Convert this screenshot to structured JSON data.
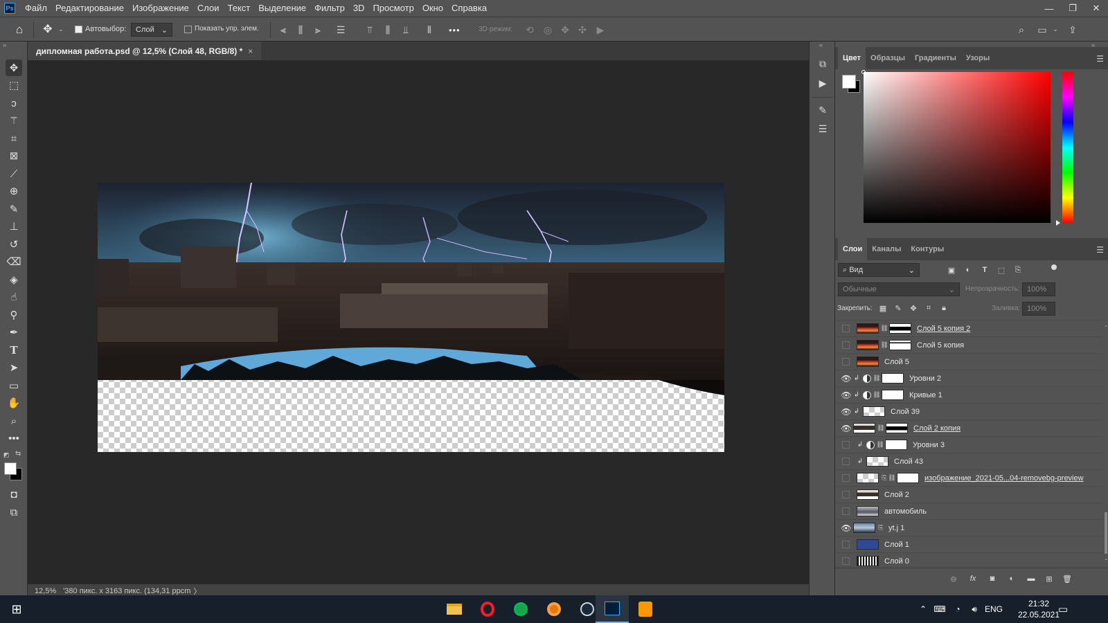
{
  "app": {
    "logo": "Ps"
  },
  "menu": [
    "Файл",
    "Редактирование",
    "Изображение",
    "Слои",
    "Текст",
    "Выделение",
    "Фильтр",
    "3D",
    "Просмотр",
    "Окно",
    "Справка"
  ],
  "options": {
    "autoselect_label": "Автовыбор:",
    "autoselect_checked": true,
    "layer_select": "Слой",
    "show_controls_label": "Показать упр. элем.",
    "show_controls_checked": false,
    "mode_3d_label": "3D-режим:",
    "more": "•••"
  },
  "document": {
    "tab_title": "дипломная работа.psd @ 12,5% (Слой 48, RGB/8) *",
    "close": "×"
  },
  "status": {
    "zoom": "12,5%",
    "info": "'380 пикс. x 3163 пикс. (134,31 ppcm",
    "arrow": "〉"
  },
  "color_panel": {
    "tabs": [
      "Цвет",
      "Образцы",
      "Градиенты",
      "Узоры"
    ],
    "active_tab": "Цвет",
    "foreground": "#ffffff",
    "background": "#000000",
    "hue_color": "#ff0000"
  },
  "layers_panel": {
    "tabs": [
      "Слои",
      "Каналы",
      "Контуры"
    ],
    "active_tab": "Слои",
    "filter_label": "Вид",
    "blend_mode": "Обычные",
    "opacity_label": "Непрозрачность:",
    "opacity_value": "100%",
    "lock_label": "Закрепить:",
    "fill_label": "Заливка:",
    "fill_value": "100%",
    "layers": [
      {
        "name": "Слой 5 копия 2",
        "visible": false,
        "thumb": "fire",
        "mask": "black-shape",
        "underline": true,
        "clip": false,
        "adj": false,
        "link": true
      },
      {
        "name": "Слой 5 копия",
        "visible": false,
        "thumb": "fire",
        "mask": "white-small",
        "underline": false,
        "clip": false,
        "adj": false,
        "link": true
      },
      {
        "name": "Слой 5",
        "visible": false,
        "thumb": "fire",
        "mask": "",
        "underline": false,
        "clip": false,
        "adj": false,
        "link": false
      },
      {
        "name": "Уровни 2",
        "visible": true,
        "thumb": "adj",
        "mask": "white",
        "underline": false,
        "clip": true,
        "adj": true,
        "link": true
      },
      {
        "name": "Кривые 1",
        "visible": true,
        "thumb": "adj",
        "mask": "white",
        "underline": false,
        "clip": true,
        "adj": true,
        "link": true
      },
      {
        "name": "Слой 39",
        "visible": true,
        "thumb": "checker",
        "mask": "",
        "underline": false,
        "clip": true,
        "adj": false,
        "link": false
      },
      {
        "name": "Слой 2 копия",
        "visible": true,
        "thumb": "city",
        "mask": "black-shape",
        "underline": true,
        "clip": false,
        "adj": false,
        "link": true
      },
      {
        "name": "Уровни 3",
        "visible": false,
        "thumb": "adj",
        "mask": "white",
        "underline": false,
        "clip": true,
        "adj": true,
        "link": true
      },
      {
        "name": "Слой 43",
        "visible": false,
        "thumb": "checker",
        "mask": "",
        "underline": false,
        "clip": true,
        "adj": false,
        "link": false
      },
      {
        "name": "изображение_2021-05...04-removebg-preview",
        "visible": false,
        "thumb": "checker",
        "mask": "white",
        "underline": true,
        "clip": false,
        "adj": false,
        "link": true,
        "smart": true
      },
      {
        "name": "Слой 2",
        "visible": false,
        "thumb": "city",
        "mask": "",
        "underline": false,
        "clip": false,
        "adj": false,
        "link": false
      },
      {
        "name": "автомобиль",
        "visible": false,
        "thumb": "car",
        "mask": "",
        "underline": false,
        "clip": false,
        "adj": false,
        "link": false
      },
      {
        "name": "yt.j 1",
        "visible": true,
        "thumb": "sky",
        "mask": "",
        "underline": false,
        "clip": false,
        "adj": false,
        "link": false,
        "smart": true
      },
      {
        "name": "Слой 1",
        "visible": false,
        "thumb": "blue",
        "mask": "",
        "underline": false,
        "clip": false,
        "adj": false,
        "link": false
      },
      {
        "name": "Слой 0",
        "visible": false,
        "thumb": "noise",
        "mask": "",
        "underline": false,
        "clip": false,
        "adj": false,
        "link": false
      }
    ]
  },
  "taskbar": {
    "apps": [
      "explorer",
      "opera",
      "app-green",
      "blender",
      "steam",
      "photoshop",
      "sublime"
    ],
    "active": "photoshop",
    "language": "ENG",
    "time": "21:32",
    "date": "22.05.2021"
  }
}
